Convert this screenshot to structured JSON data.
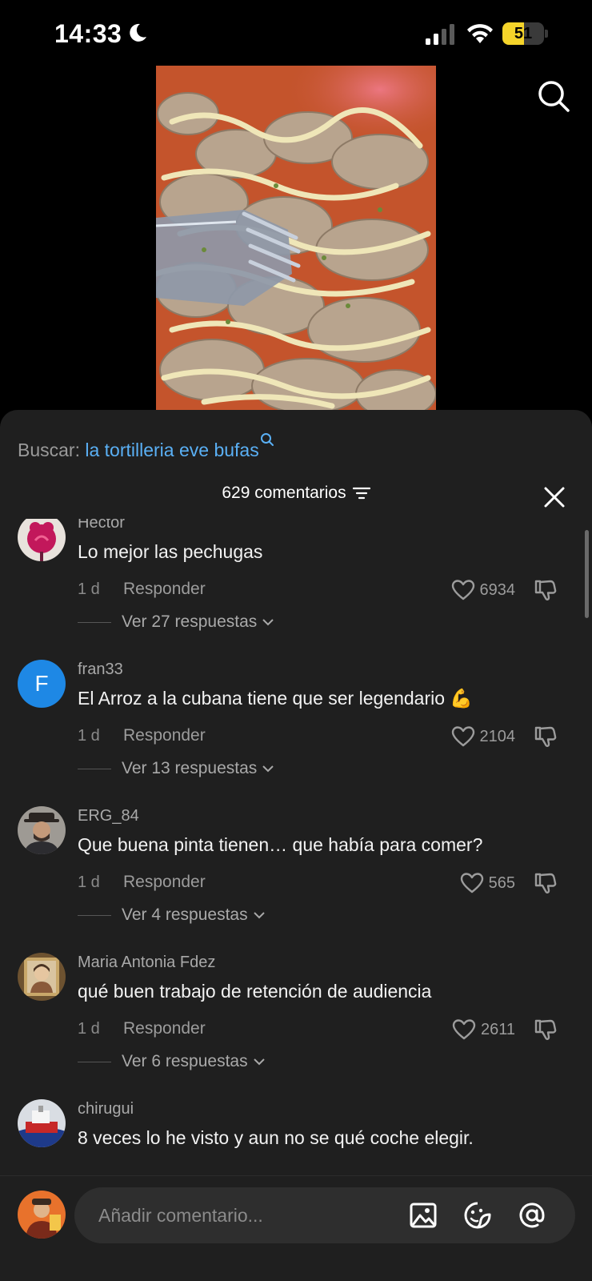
{
  "status_bar": {
    "time": "14:33",
    "battery_level": "51",
    "battery_fill_fraction": 0.51,
    "battery_color": "#f5d42a"
  },
  "video": {
    "thumbnail": "plate-of-fried-food-with-fork"
  },
  "search_suggestion": {
    "prefix": "Buscar: ",
    "term": "la tortilleria eve bufas",
    "term_color": "#5ab0f5"
  },
  "comments_header": {
    "count_label": "629 comentarios"
  },
  "comments": [
    {
      "username": "Hector",
      "text": "Lo mejor las pechugas",
      "age": "1 d",
      "reply_label": "Responder",
      "likes": "6934",
      "replies_label": "Ver 27 respuestas"
    },
    {
      "username": "fran33",
      "text": "El Arroz a la cubana tiene que ser legendario 💪",
      "age": "1 d",
      "reply_label": "Responder",
      "likes": "2104",
      "replies_label": "Ver 13 respuestas",
      "avatar_letter": "F",
      "avatar_color": "#1e88e5"
    },
    {
      "username": "ERG_84",
      "text": "Que buena pinta tienen… que había para comer?",
      "age": "1 d",
      "reply_label": "Responder",
      "likes": "565",
      "replies_label": "Ver 4 respuestas"
    },
    {
      "username": "Maria Antonia Fdez",
      "text": "qué buen trabajo de retención de audiencia",
      "age": "1 d",
      "reply_label": "Responder",
      "likes": "2611",
      "replies_label": "Ver 6 respuestas"
    },
    {
      "username": "chirugui",
      "text": "8 veces lo he visto y aun no se qué coche elegir."
    }
  ],
  "composer": {
    "placeholder": "Añadir comentario..."
  },
  "icons": {
    "search": "search-icon",
    "filter": "filter-icon",
    "close": "close-icon",
    "heart": "heart-icon",
    "dislike": "dislike-icon",
    "image": "image-icon",
    "emoji": "emoji-icon",
    "mention": "at-icon"
  }
}
